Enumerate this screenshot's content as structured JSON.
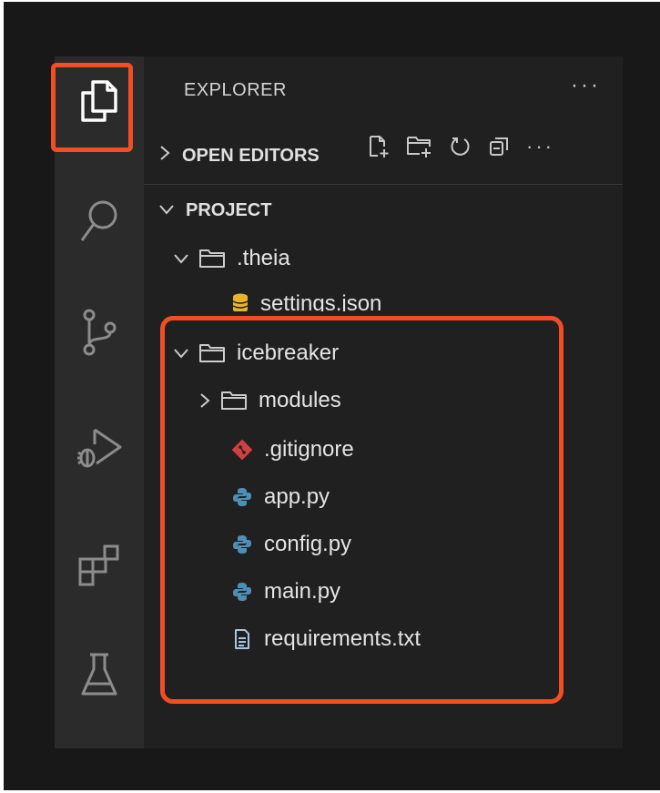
{
  "activity_bar": {
    "icons": [
      "explorer-icon",
      "search-icon",
      "source-control-icon",
      "run-debug-icon",
      "extensions-icon",
      "testing-icon"
    ]
  },
  "explorer": {
    "title": "EXPLORER",
    "more": "···"
  },
  "sections": {
    "open_editors": "OPEN EDITORS",
    "project": "PROJECT",
    "project_more": "···"
  },
  "tree": {
    "theia": ".theia",
    "settings": "settings.json",
    "icebreaker": "icebreaker",
    "modules": "modules",
    "gitignore": ".gitignore",
    "app": "app.py",
    "config": "config.py",
    "main": "main.py",
    "requirements": "requirements.txt"
  },
  "colors": {
    "highlight": "#f24e24",
    "python": "#4e8fb8",
    "git": "#d04040",
    "json": "#e8b42a"
  }
}
